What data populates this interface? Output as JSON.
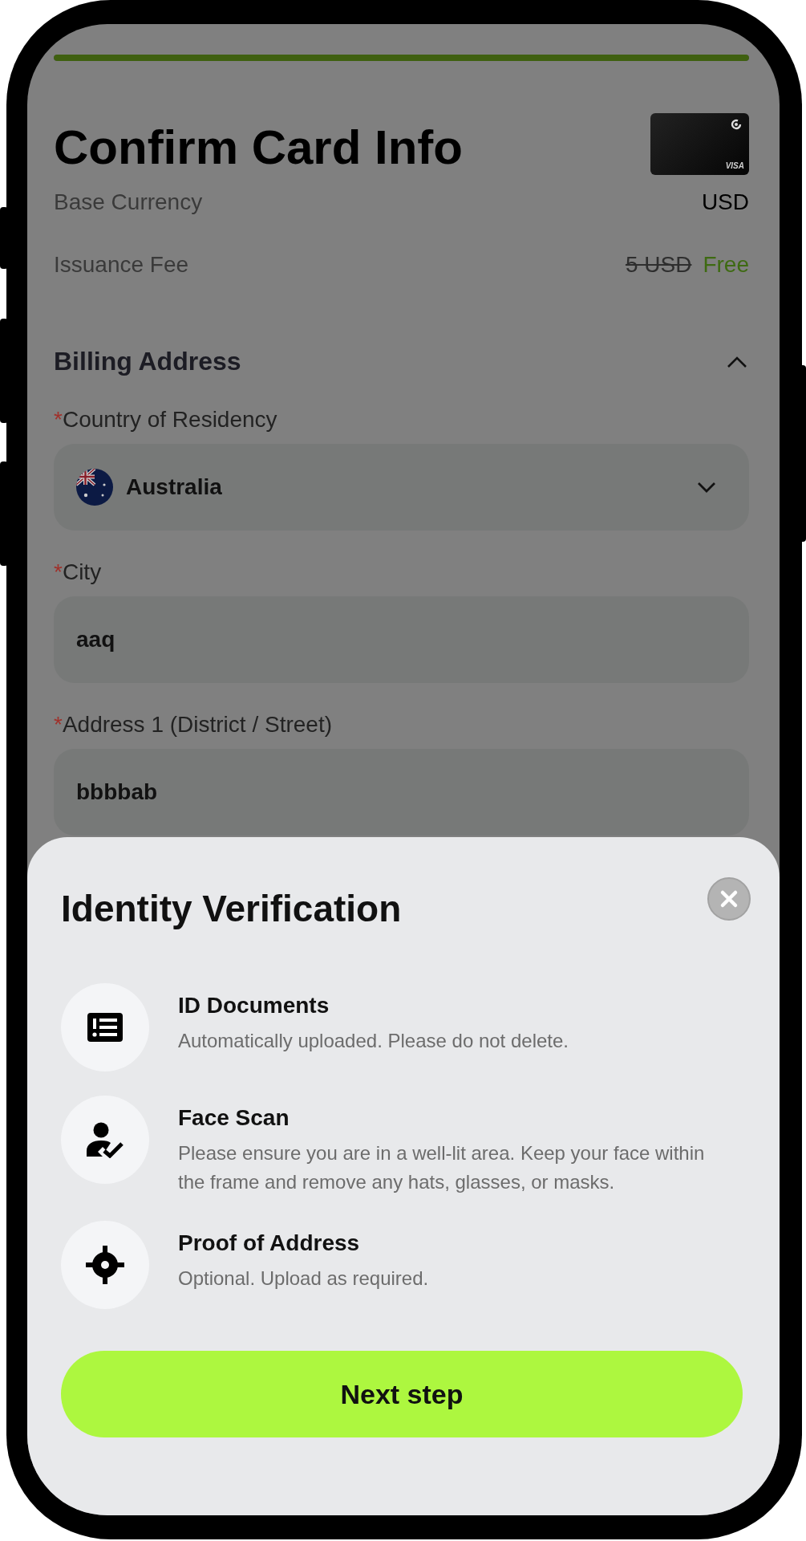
{
  "progress": {
    "level": 1
  },
  "title": "Confirm Card Info",
  "card": {
    "brand": "VISA"
  },
  "summary": [
    {
      "kind": "plain",
      "label": "Base Currency",
      "value": "USD"
    },
    {
      "kind": "discount",
      "label": "Issuance Fee",
      "old_value": "5 USD",
      "value": "Free"
    }
  ],
  "section": {
    "title": "Billing Address",
    "expanded": true
  },
  "fields": [
    {
      "kind": "select",
      "required_mark": "*",
      "label": "Country of Residency",
      "value": "Australia"
    },
    {
      "kind": "text",
      "required_mark": "*",
      "label": "City",
      "value": "aaq"
    },
    {
      "kind": "text",
      "required_mark": "*",
      "label": "Address 1 (District / Street)",
      "value": "bbbbab"
    }
  ],
  "sheet": {
    "title": "Identity Verification",
    "items": [
      {
        "kind": "documents",
        "title": "ID Documents",
        "description": "Automatically uploaded. Please do not delete."
      },
      {
        "kind": "face",
        "title": "Face Scan",
        "description": "Please ensure you are in a well-lit area. Keep your face within the frame and remove any hats, glasses, or masks."
      },
      {
        "kind": "address",
        "title": "Proof of Address",
        "description": "Optional. Upload as required."
      }
    ],
    "button": "Next step"
  }
}
